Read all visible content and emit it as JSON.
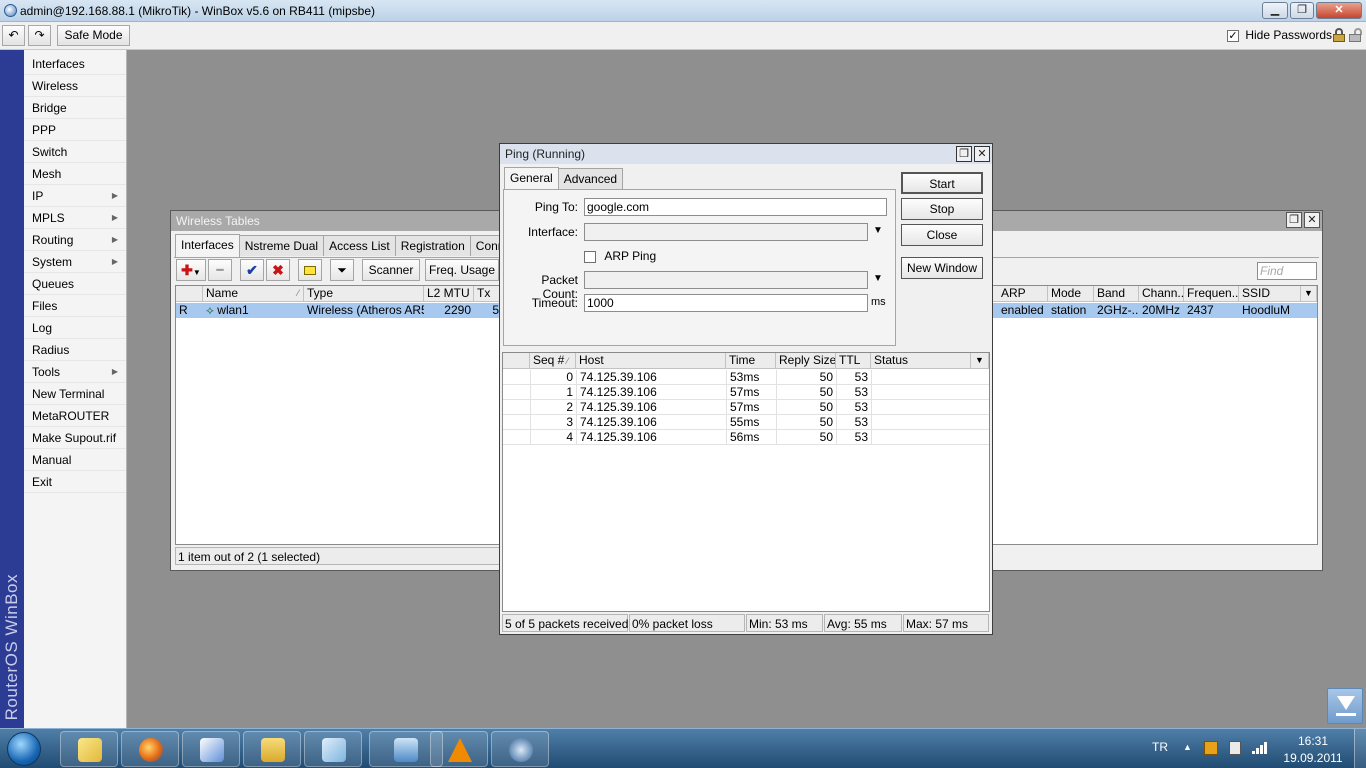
{
  "title": "admin@192.168.88.1 (MikroTik) - WinBox v5.6 on RB411 (mipsbe)",
  "toolbar": {
    "safe_mode": "Safe Mode",
    "hide_passwords": "Hide Passwords",
    "hide_passwords_checked": true
  },
  "brand": "RouterOS WinBox",
  "menu": [
    {
      "label": "Interfaces",
      "submenu": false
    },
    {
      "label": "Wireless",
      "submenu": false
    },
    {
      "label": "Bridge",
      "submenu": false
    },
    {
      "label": "PPP",
      "submenu": false
    },
    {
      "label": "Switch",
      "submenu": false
    },
    {
      "label": "Mesh",
      "submenu": false
    },
    {
      "label": "IP",
      "submenu": true
    },
    {
      "label": "MPLS",
      "submenu": true
    },
    {
      "label": "Routing",
      "submenu": true
    },
    {
      "label": "System",
      "submenu": true
    },
    {
      "label": "Queues",
      "submenu": false
    },
    {
      "label": "Files",
      "submenu": false
    },
    {
      "label": "Log",
      "submenu": false
    },
    {
      "label": "Radius",
      "submenu": false
    },
    {
      "label": "Tools",
      "submenu": true
    },
    {
      "label": "New Terminal",
      "submenu": false
    },
    {
      "label": "MetaROUTER",
      "submenu": false
    },
    {
      "label": "Make Supout.rif",
      "submenu": false
    },
    {
      "label": "Manual",
      "submenu": false
    },
    {
      "label": "Exit",
      "submenu": false
    }
  ],
  "wireless": {
    "title": "Wireless Tables",
    "tabs": [
      "Interfaces",
      "Nstreme Dual",
      "Access List",
      "Registration",
      "Connect L"
    ],
    "buttons": {
      "scanner": "Scanner",
      "freq_usage": "Freq. Usage"
    },
    "find_placeholder": "Find",
    "columns_left": [
      "Name",
      "Type",
      "L2 MTU",
      "Tx"
    ],
    "columns_right": [
      "ARP",
      "Mode",
      "Band",
      "Chann...",
      "Frequen...",
      "SSID"
    ],
    "row": {
      "flag": "R",
      "name": "wlan1",
      "type": "Wireless (Atheros AR5...",
      "l2mtu": "2290",
      "tx": "5",
      "arp": "enabled",
      "mode": "station",
      "band": "2GHz-...",
      "channel": "20MHz",
      "frequency": "2437",
      "ssid": "HoodluM"
    },
    "status": "1 item out of 2 (1 selected)"
  },
  "ping": {
    "title": "Ping (Running)",
    "tabs": [
      "General",
      "Advanced"
    ],
    "labels": {
      "ping_to": "Ping To:",
      "interface": "Interface:",
      "arp_ping": "ARP Ping",
      "packet_count": "Packet Count:",
      "timeout": "Timeout:",
      "ms": "ms"
    },
    "values": {
      "ping_to": "google.com",
      "interface": "",
      "packet_count": "",
      "timeout": "1000"
    },
    "buttons": {
      "start": "Start",
      "stop": "Stop",
      "close": "Close",
      "new_window": "New Window"
    },
    "columns": [
      "Seq #",
      "Host",
      "Time",
      "Reply Size",
      "TTL",
      "Status"
    ],
    "rows": [
      {
        "seq": "0",
        "host": "74.125.39.106",
        "time": "53ms",
        "size": "50",
        "ttl": "53",
        "status": ""
      },
      {
        "seq": "1",
        "host": "74.125.39.106",
        "time": "57ms",
        "size": "50",
        "ttl": "53",
        "status": ""
      },
      {
        "seq": "2",
        "host": "74.125.39.106",
        "time": "57ms",
        "size": "50",
        "ttl": "53",
        "status": ""
      },
      {
        "seq": "3",
        "host": "74.125.39.106",
        "time": "55ms",
        "size": "50",
        "ttl": "53",
        "status": ""
      },
      {
        "seq": "4",
        "host": "74.125.39.106",
        "time": "56ms",
        "size": "50",
        "ttl": "53",
        "status": ""
      }
    ],
    "status": {
      "received": "5 of 5 packets received",
      "loss": "0% packet loss",
      "min": "Min: 53 ms",
      "avg": "Avg: 55 ms",
      "max": "Max: 57 ms"
    }
  },
  "taskbar": {
    "apps": [
      "windows-explorer-icon",
      "firefox-icon",
      "winbox-icon",
      "folder-icon",
      "notepad-icon",
      "remote-desktop-icon",
      "vlc-icon",
      "network-icon"
    ],
    "tray": {
      "lang": "TR",
      "time": "16:31",
      "date": "19.09.2011"
    }
  }
}
